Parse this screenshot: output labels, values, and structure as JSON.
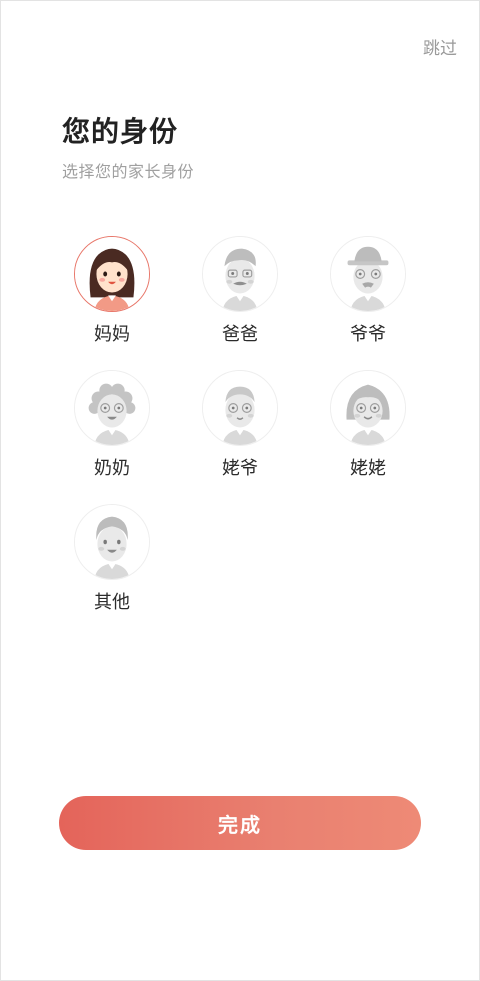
{
  "header": {
    "skip_label": "跳过"
  },
  "page": {
    "title": "您的身份",
    "subtitle": "选择您的家长身份"
  },
  "options": [
    {
      "label": "妈妈",
      "selected": true
    },
    {
      "label": "爸爸",
      "selected": false
    },
    {
      "label": "爷爷",
      "selected": false
    },
    {
      "label": "奶奶",
      "selected": false
    },
    {
      "label": "姥爷",
      "selected": false
    },
    {
      "label": "姥姥",
      "selected": false
    },
    {
      "label": "其他",
      "selected": false
    }
  ],
  "footer": {
    "done_label": "完成"
  },
  "colors": {
    "accent": "#e8776a",
    "selected_border": "#e8776a",
    "grey_avatar": "#cfcfcf"
  }
}
